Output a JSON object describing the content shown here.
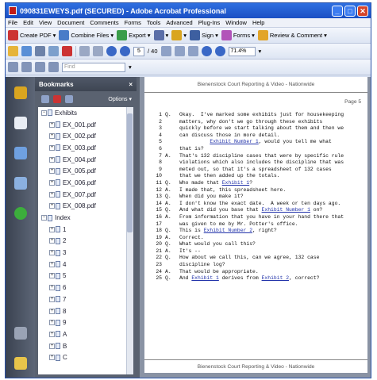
{
  "window": {
    "title": "090831EWEYS.pdf (SECURED) - Adobe Acrobat Professional"
  },
  "menu": [
    "File",
    "Edit",
    "View",
    "Document",
    "Comments",
    "Forms",
    "Tools",
    "Advanced",
    "Plug-Ins",
    "Window",
    "Help"
  ],
  "toolbar1": {
    "create": "Create PDF",
    "combine": "Combine Files",
    "export": "Export",
    "sign": "Sign",
    "forms": "Forms",
    "review": "Review & Comment"
  },
  "toolbar2": {
    "page": "5",
    "of": "/ 40",
    "zoom": "71.4%"
  },
  "find": {
    "placeholder": "Find"
  },
  "bookmarks": {
    "title": "Bookmarks",
    "options": "Options",
    "items": [
      {
        "label": "Exhibits",
        "level": 0,
        "folder": true
      },
      {
        "label": "EX_001.pdf",
        "level": 1
      },
      {
        "label": "EX_002.pdf",
        "level": 1
      },
      {
        "label": "EX_003.pdf",
        "level": 1
      },
      {
        "label": "EX_004.pdf",
        "level": 1
      },
      {
        "label": "EX_005.pdf",
        "level": 1
      },
      {
        "label": "EX_006.pdf",
        "level": 1
      },
      {
        "label": "EX_007.pdf",
        "level": 1
      },
      {
        "label": "EX_008.pdf",
        "level": 1
      },
      {
        "label": "Index",
        "level": 0,
        "folder": true
      },
      {
        "label": "1",
        "level": 1
      },
      {
        "label": "2",
        "level": 1
      },
      {
        "label": "3",
        "level": 1
      },
      {
        "label": "4",
        "level": 1
      },
      {
        "label": "5",
        "level": 1
      },
      {
        "label": "6",
        "level": 1
      },
      {
        "label": "7",
        "level": 1
      },
      {
        "label": "8",
        "level": 1
      },
      {
        "label": "9",
        "level": 1
      },
      {
        "label": "A",
        "level": 1
      },
      {
        "label": "B",
        "level": 1
      },
      {
        "label": "C",
        "level": 1
      }
    ]
  },
  "document": {
    "header": "Bienenstock Court Reporting & Video - Nationwide",
    "page_label": "Page 5",
    "footer": "Bienenstock Court Reporting & Video - Nationwide",
    "lines": [
      {
        "n": "1",
        "s": "Q.",
        "t": "Okay.  I've marked some exhibits just for housekeeping"
      },
      {
        "n": "2",
        "s": "",
        "t": "matters, why don't we go through these exhibits"
      },
      {
        "n": "3",
        "s": "",
        "t": "quickly before we start talking about them and then we"
      },
      {
        "n": "4",
        "s": "",
        "t": "can discuss those in more detail."
      },
      {
        "n": "5",
        "s": "",
        "t": "          Exhibit Number 1, would you tell me what"
      },
      {
        "n": "6",
        "s": "",
        "t": "that is?"
      },
      {
        "n": "7",
        "s": "A.",
        "t": "That's 132 discipline cases that were by specific rule"
      },
      {
        "n": "8",
        "s": "",
        "t": "violations which also includes the discipline that was"
      },
      {
        "n": "9",
        "s": "",
        "t": "meted out, so that it's a spreadsheet of 132 cases"
      },
      {
        "n": "10",
        "s": "",
        "t": "that we then added up the totals."
      },
      {
        "n": "11",
        "s": "Q.",
        "t": "Who made that Exhibit 1?"
      },
      {
        "n": "12",
        "s": "A.",
        "t": "I made that, this spreadsheet here."
      },
      {
        "n": "13",
        "s": "Q.",
        "t": "When did you make it?"
      },
      {
        "n": "14",
        "s": "A.",
        "t": "I don't know the exact date.  A week or ten days ago."
      },
      {
        "n": "15",
        "s": "Q.",
        "t": "And what did you base that Exhibit Number 1 on?"
      },
      {
        "n": "16",
        "s": "A.",
        "t": "From information that you have in your hand there that"
      },
      {
        "n": "17",
        "s": "",
        "t": "was given to me by Mr. Potter's office."
      },
      {
        "n": "18",
        "s": "Q.",
        "t": "This is Exhibit Number 2, right?"
      },
      {
        "n": "19",
        "s": "A.",
        "t": "Correct."
      },
      {
        "n": "20",
        "s": "Q.",
        "t": "What would you call this?"
      },
      {
        "n": "21",
        "s": "A.",
        "t": "It's --"
      },
      {
        "n": "22",
        "s": "Q.",
        "t": "How about we call this, can we agree, 132 case"
      },
      {
        "n": "23",
        "s": "",
        "t": "discipline log?"
      },
      {
        "n": "24",
        "s": "A.",
        "t": "That would be appropriate."
      },
      {
        "n": "25",
        "s": "Q.",
        "t": "And Exhibit 1 derives from Exhibit 2, correct?"
      }
    ]
  }
}
